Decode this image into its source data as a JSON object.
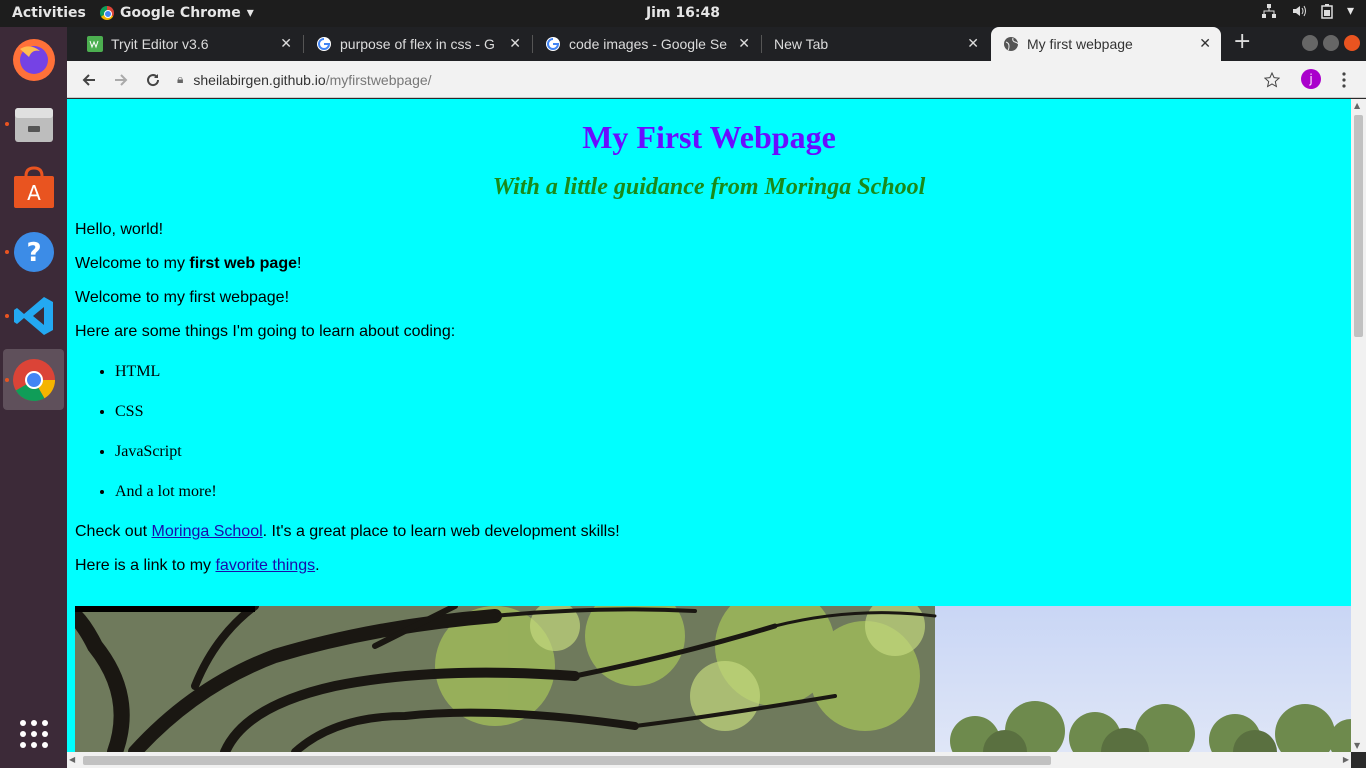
{
  "topbar": {
    "activities": "Activities",
    "app_name": "Google Chrome",
    "clock": "Jim 16:48"
  },
  "dock": {
    "items": [
      "firefox-icon",
      "files-icon",
      "software-icon",
      "help-icon",
      "vscode-icon",
      "chrome-icon",
      "app-grid-icon"
    ]
  },
  "tabs": [
    {
      "title": "Tryit Editor v3.6",
      "icon": "w3schools-icon",
      "active": false
    },
    {
      "title": "purpose of flex in css - G",
      "icon": "google-icon",
      "active": false
    },
    {
      "title": "code images - Google Se",
      "icon": "google-icon",
      "active": false
    },
    {
      "title": "New Tab",
      "icon": "",
      "active": false
    },
    {
      "title": "My first webpage",
      "icon": "globe-icon",
      "active": true
    }
  ],
  "address_bar": {
    "host": "sheilabirgen.github.io",
    "path": "/myfirstwebpage/"
  },
  "profile_initial": "j",
  "page": {
    "heading": "My First Webpage",
    "subheading": "With a little guidance from Moringa School",
    "p1": "Hello, world!",
    "p2_pre": "Welcome to my ",
    "p2_bold": "first web page",
    "p2_post": "!",
    "p3": "Welcome to my first webpage!",
    "p4": "Here are some things I'm going to learn about coding:",
    "list": [
      "HTML",
      "CSS",
      "JavaScript",
      "And a lot more!"
    ],
    "p5_pre": "Check out ",
    "p5_link": "Moringa School",
    "p5_post": ". It's a great place to learn web development skills!",
    "p6_pre": "Here is a link to my ",
    "p6_link": "favorite things",
    "p6_post": "."
  },
  "colors": {
    "page_bg": "#00ffff",
    "heading": "#6a0dff",
    "subheading": "#1a8a1a",
    "link": "#1a0dab"
  }
}
